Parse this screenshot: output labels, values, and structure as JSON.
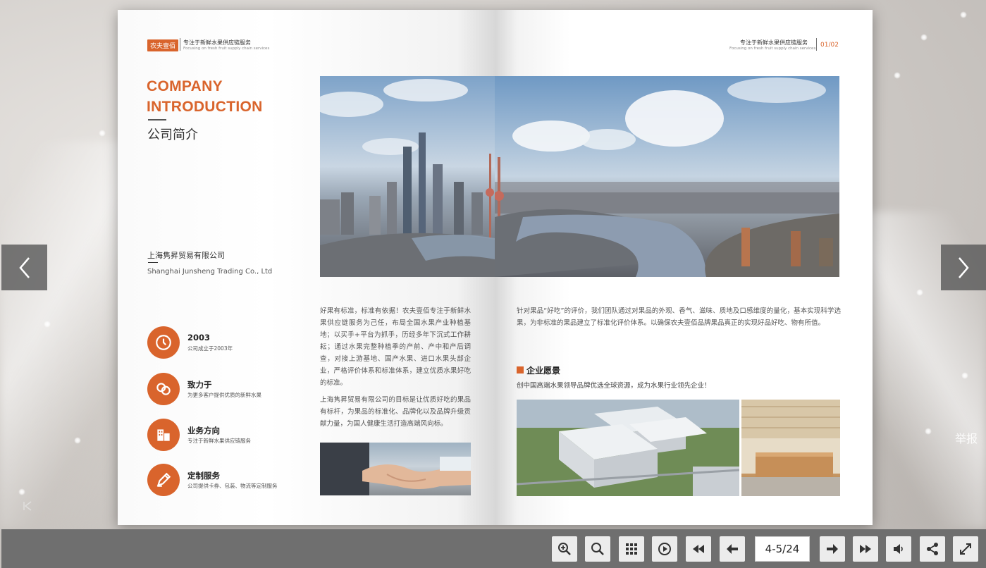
{
  "viewer": {
    "report_label": "举报",
    "page_indicator": "4-5/24"
  },
  "left_page": {
    "brand_tag": "农夫壹佰",
    "brand_slogan_cn": "专注于新鲜水果供应链服务",
    "brand_slogan_en": "Focusing on fresh fruit supply chain services",
    "title_en_line1": "COMPANY",
    "title_en_line2": "INTRODUCTION",
    "title_cn": "公司简介",
    "company_cn": "上海隽昇贸易有限公司",
    "company_en": "Shanghai Junsheng Trading Co., Ltd",
    "features": [
      {
        "title": "2003",
        "desc": "公司成立于2003年",
        "icon": "clock-icon"
      },
      {
        "title": "致力于",
        "desc": "为更多客户提供优质的新鲜水果",
        "icon": "link-icon"
      },
      {
        "title": "业务方向",
        "desc": "专注于新鲜水果供应链服务",
        "icon": "building-icon"
      },
      {
        "title": "定制服务",
        "desc": "公司提供卡券、包装、物流等定制服务",
        "icon": "edit-icon"
      }
    ],
    "paragraph1": "好果有标准，标准有依据！农夫壹佰专注于新鲜水果供应链服务为己任，布局全国水果产业种植基地；以买手+平台为抓手，历经多年下沉式工作耕耘；通过水果完整种植季的产前、产中和产后调查，对接上游基地、国产水果、进口水果头部企业，严格评价体系和标准体系，建立优质水果好吃的标准。",
    "paragraph2": "上海隽昇贸易有限公司的目标是让优质好吃的果品有标杆，为果品的标准化、品牌化以及品牌升级贡献力量，为国人健康生活打造高端风向标。"
  },
  "right_page": {
    "header_cn": "专注于新鲜水果供应链服务",
    "header_en": "Focusing on fresh fruit supply chain services",
    "page_number": "01/02",
    "paragraph3": "针对果品“好吃”的评价，我们团队通过对果品的外观、香气、滋味、质地及口感维度的量化，基本实现科学选果，为非标准的果品建立了标准化评价体系。以确保农夫壹佰品牌果品真正的实现好品好吃、物有所值。",
    "vision_title": "企业愿景",
    "vision_text": "创中国高端水果领导品牌优选全球资源，成为水果行业领先企业！"
  },
  "colors": {
    "accent": "#d9642c",
    "toolbar_bg": "#6f6f6f",
    "toolbar_button": "#ececec"
  },
  "toolbar_buttons": [
    "zoom-in-icon",
    "search-icon",
    "thumbnails-icon",
    "autoplay-icon",
    "first-page-icon",
    "previous-page-icon",
    "next-page-icon",
    "last-page-icon",
    "sound-icon",
    "share-icon",
    "fullscreen-icon"
  ]
}
